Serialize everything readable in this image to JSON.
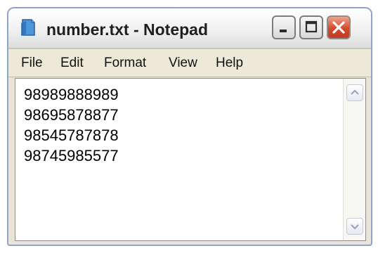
{
  "window": {
    "title": "number.txt - Notepad",
    "app_icon": "notepad-icon"
  },
  "controls": {
    "minimize_icon": "minimize-icon",
    "maximize_icon": "maximize-icon",
    "close_icon": "close-icon",
    "close_color": "#d44a2b"
  },
  "menu": {
    "items": [
      "File",
      "Edit",
      "Format",
      "View",
      "Help"
    ]
  },
  "editor": {
    "lines": [
      "98989888989",
      "98695878877",
      "98545787878",
      "98745985577"
    ]
  },
  "scrollbar": {
    "up_icon": "scroll-up-arrow-icon",
    "down_icon": "scroll-down-arrow-icon"
  }
}
